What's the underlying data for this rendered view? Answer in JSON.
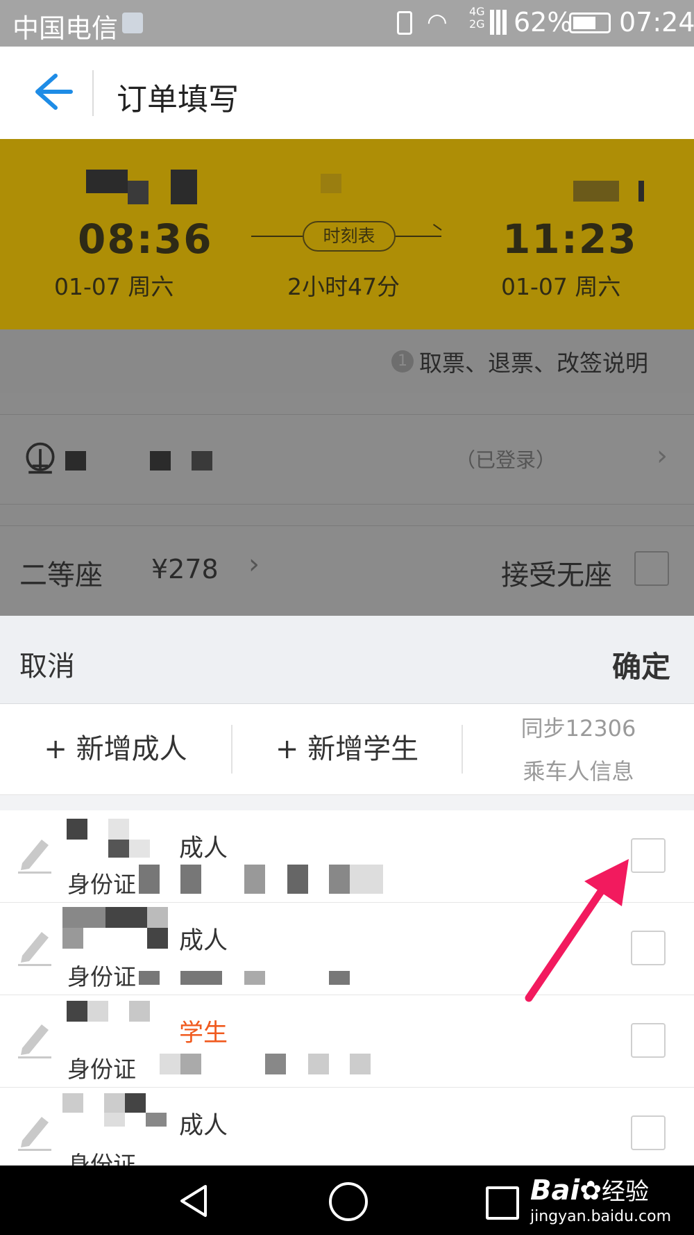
{
  "status_bar": {
    "carrier": "中国电信",
    "battery": "62%",
    "time": "07:24",
    "network": "4G 2G"
  },
  "header": {
    "title": "订单填写",
    "back_icon": "back-arrow-icon"
  },
  "train": {
    "depart_time": "08:36",
    "depart_date": "01-07  周六",
    "timetable_label": "时刻表",
    "duration": "2小时47分",
    "arrive_time": "11:23",
    "arrive_date": "01-07  周六",
    "background": "#ae8e06"
  },
  "rules_link": "取票、退票、改签说明",
  "account": {
    "status": "（已登录）"
  },
  "seat": {
    "class": "二等座",
    "price": "¥278",
    "no_seat_label": "接受无座"
  },
  "sheet": {
    "cancel": "取消",
    "confirm": "确定",
    "add_adult": "+ 新增成人",
    "add_student": "+ 新增学生",
    "sync_line1": "同步12306",
    "sync_line2": "乘车人信息",
    "passengers": [
      {
        "type": "成人",
        "id_label": "身份证"
      },
      {
        "type": "成人",
        "id_label": "身份证"
      },
      {
        "type": "学生",
        "id_label": "身份证"
      },
      {
        "type": "成人",
        "id_label": "身份证"
      }
    ]
  },
  "watermark": {
    "brand": "Bai",
    "brand2": "经验",
    "url": "jingyan.baidu.com"
  },
  "colors": {
    "accent": "#1e8ce6",
    "student": "#f05a1e",
    "annotation_arrow": "#f21a5e"
  }
}
